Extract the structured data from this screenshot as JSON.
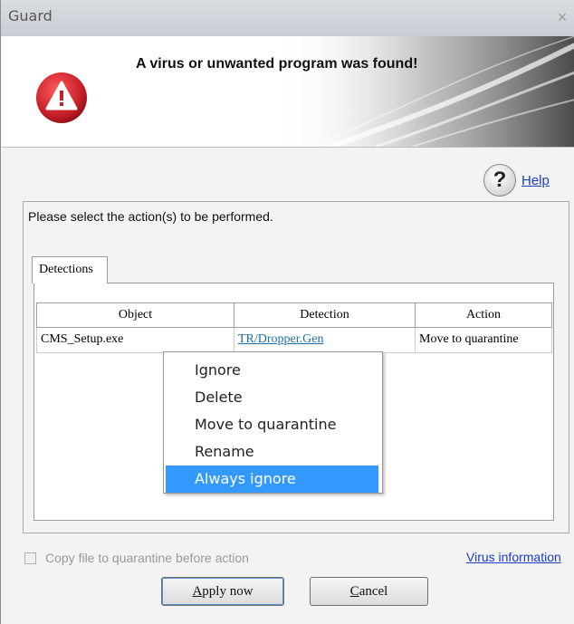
{
  "window": {
    "title": "Guard",
    "close_glyph": "×"
  },
  "banner": {
    "headline": "A virus or unwanted program was found!",
    "icon": "warning-icon"
  },
  "help": {
    "icon": "question-mark-icon",
    "glyph": "?",
    "label": "Help"
  },
  "instructions": "Please select the action(s) to be performed.",
  "tabs": [
    {
      "label": "Detections"
    }
  ],
  "detections_table": {
    "columns": [
      "Object",
      "Detection",
      "Action"
    ],
    "rows": [
      {
        "object": "CMS_Setup.exe",
        "detection": "TR/Dropper.Gen",
        "action": "Move to quarantine"
      }
    ]
  },
  "context_menu": {
    "items": [
      "Ignore",
      "Delete",
      "Move to quarantine",
      "Rename",
      "Always ignore"
    ],
    "selected": "Always ignore"
  },
  "checkbox": {
    "label": "Copy file to quarantine before action",
    "checked": false,
    "enabled": false
  },
  "virus_info_link": "Virus information",
  "buttons": {
    "apply": {
      "mnemonic": "A",
      "rest": "pply now"
    },
    "cancel": {
      "mnemonic": "C",
      "rest": "ancel"
    }
  },
  "colors": {
    "selection": "#3399ff",
    "warning_red": "#c8202a",
    "link": "#1a3ec8"
  }
}
